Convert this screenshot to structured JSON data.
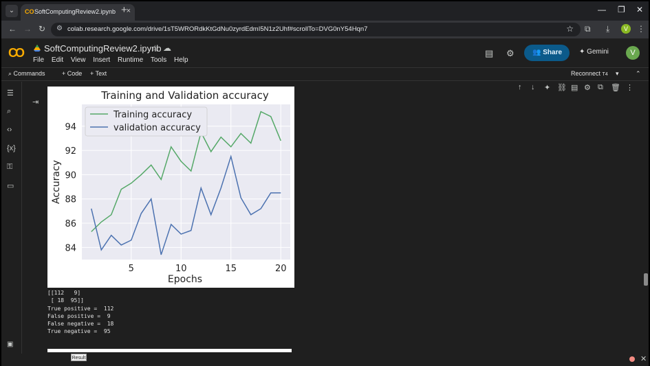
{
  "browser": {
    "tab_title": "SoftComputingReview2.ipynb",
    "tab_logo": "CO",
    "url": "colab.research.google.com/drive/1sT5WRORdkKtGdNu0zyrdEdmI5N1z2Uhf#scrollTo=DVG0nY54Hqn7",
    "profile_initial": "V"
  },
  "colab": {
    "logo": "CO",
    "notebook_title": "SoftComputingReview2.ipynb",
    "menu": [
      "File",
      "Edit",
      "View",
      "Insert",
      "Runtime",
      "Tools",
      "Help"
    ],
    "share_label": "Share",
    "gemini_label": "Gemini",
    "avatar_initial": "V"
  },
  "toolbar": {
    "commands": "Commands",
    "code": "+ Code",
    "text": "+ Text",
    "reconnect": "Reconnect",
    "reconnect_badge": "T4"
  },
  "output": {
    "lines": [
      "[[112   9]",
      " [ 18  95]]",
      "True positive =  112",
      "False positive =  9",
      "False negative =  18",
      "True negative =  95"
    ],
    "tooltip": "Result"
  },
  "chart_data": {
    "type": "line",
    "title": "Training and Validation accuracy",
    "xlabel": "Epochs",
    "ylabel": "Accuracy",
    "xlim": [
      0.05,
      20.95
    ],
    "ylim": [
      83.0,
      95.8
    ],
    "xticks": [
      5,
      10,
      15,
      20
    ],
    "yticks": [
      84,
      86,
      88,
      90,
      92,
      94
    ],
    "grid": true,
    "legend_position": "upper-left",
    "x": [
      1,
      2,
      3,
      4,
      5,
      6,
      7,
      8,
      9,
      10,
      11,
      12,
      13,
      14,
      15,
      16,
      17,
      18,
      19,
      20
    ],
    "series": [
      {
        "name": "Training accuracy",
        "color": "#55a868",
        "values": [
          85.3,
          86.1,
          86.7,
          88.8,
          89.3,
          90.0,
          90.8,
          89.6,
          92.3,
          91.1,
          90.3,
          93.5,
          91.9,
          93.1,
          92.3,
          93.4,
          92.6,
          95.2,
          94.8,
          92.8
        ]
      },
      {
        "name": "validation accuracy",
        "color": "#4c72b0",
        "values": [
          87.2,
          83.8,
          85.0,
          84.2,
          84.6,
          86.8,
          88.0,
          83.4,
          85.9,
          85.1,
          85.4,
          88.9,
          86.7,
          88.9,
          91.5,
          88.1,
          86.7,
          87.2,
          88.5,
          88.5
        ]
      }
    ]
  }
}
